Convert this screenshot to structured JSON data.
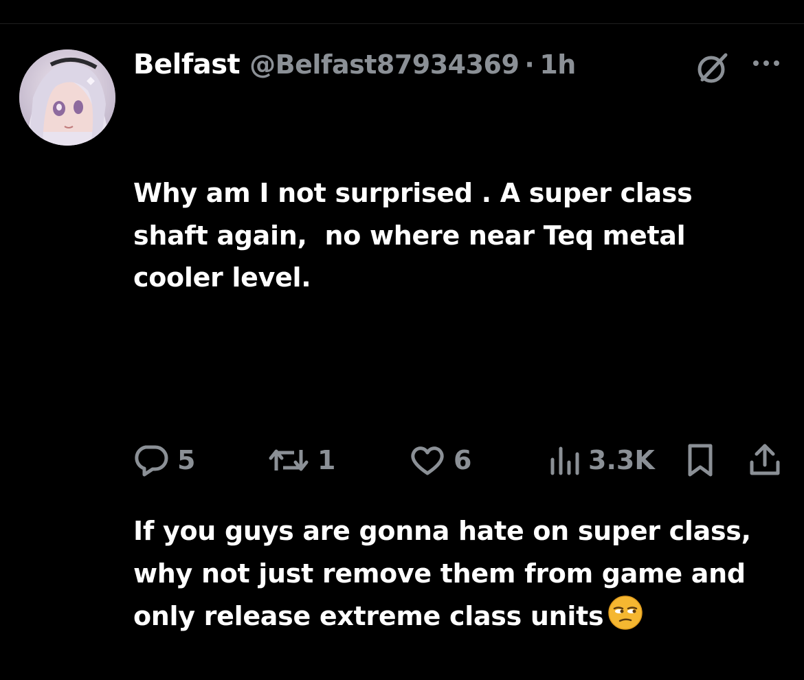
{
  "tweet": {
    "display_name": "Belfast",
    "handle": "@Belfast87934369",
    "separator": "·",
    "time": "1h",
    "paragraph_1": "Why am I not surprised . A super class shaft again,  no where near Teq metal cooler level.",
    "paragraph_2": "If you guys are gonna hate on super class, why not just remove them from game and only release extreme class units",
    "emoji": "unamused-face-emoji"
  },
  "header_icons": {
    "grok": "grok-icon",
    "more": "more-icon"
  },
  "actions": {
    "replies": "5",
    "reposts": "1",
    "likes": "6",
    "views": "3.3K"
  },
  "colors": {
    "background": "#000000",
    "text_primary": "#ffffff",
    "text_secondary": "#8b9096",
    "emoji_yellow": "#f5b731"
  }
}
